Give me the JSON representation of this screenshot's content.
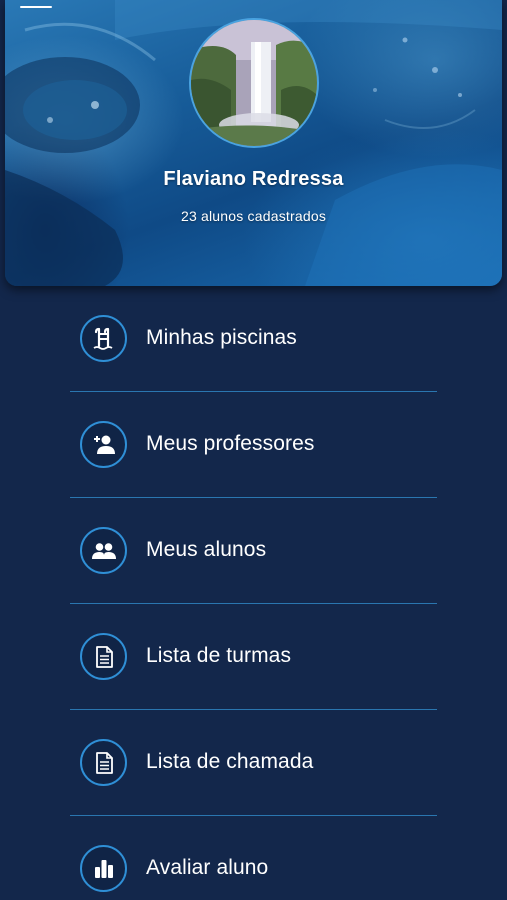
{
  "header": {
    "user_name": "Flaviano Redressa",
    "subtitle": "23 alunos cadastrados",
    "menu_icon": "hamburger-menu-icon"
  },
  "menu": {
    "items": [
      {
        "label": "Minhas piscinas",
        "icon": "pool-ladder-icon"
      },
      {
        "label": "Meus professores",
        "icon": "add-user-icon"
      },
      {
        "label": "Meus alunos",
        "icon": "users-group-icon"
      },
      {
        "label": "Lista de turmas",
        "icon": "document-icon"
      },
      {
        "label": "Lista de chamada",
        "icon": "document-icon"
      },
      {
        "label": "Avaliar aluno",
        "icon": "bar-chart-icon"
      }
    ]
  },
  "colors": {
    "background": "#13274b",
    "accent": "#2f8fd6",
    "divider": "#2a76b0",
    "text": "#ffffff"
  }
}
